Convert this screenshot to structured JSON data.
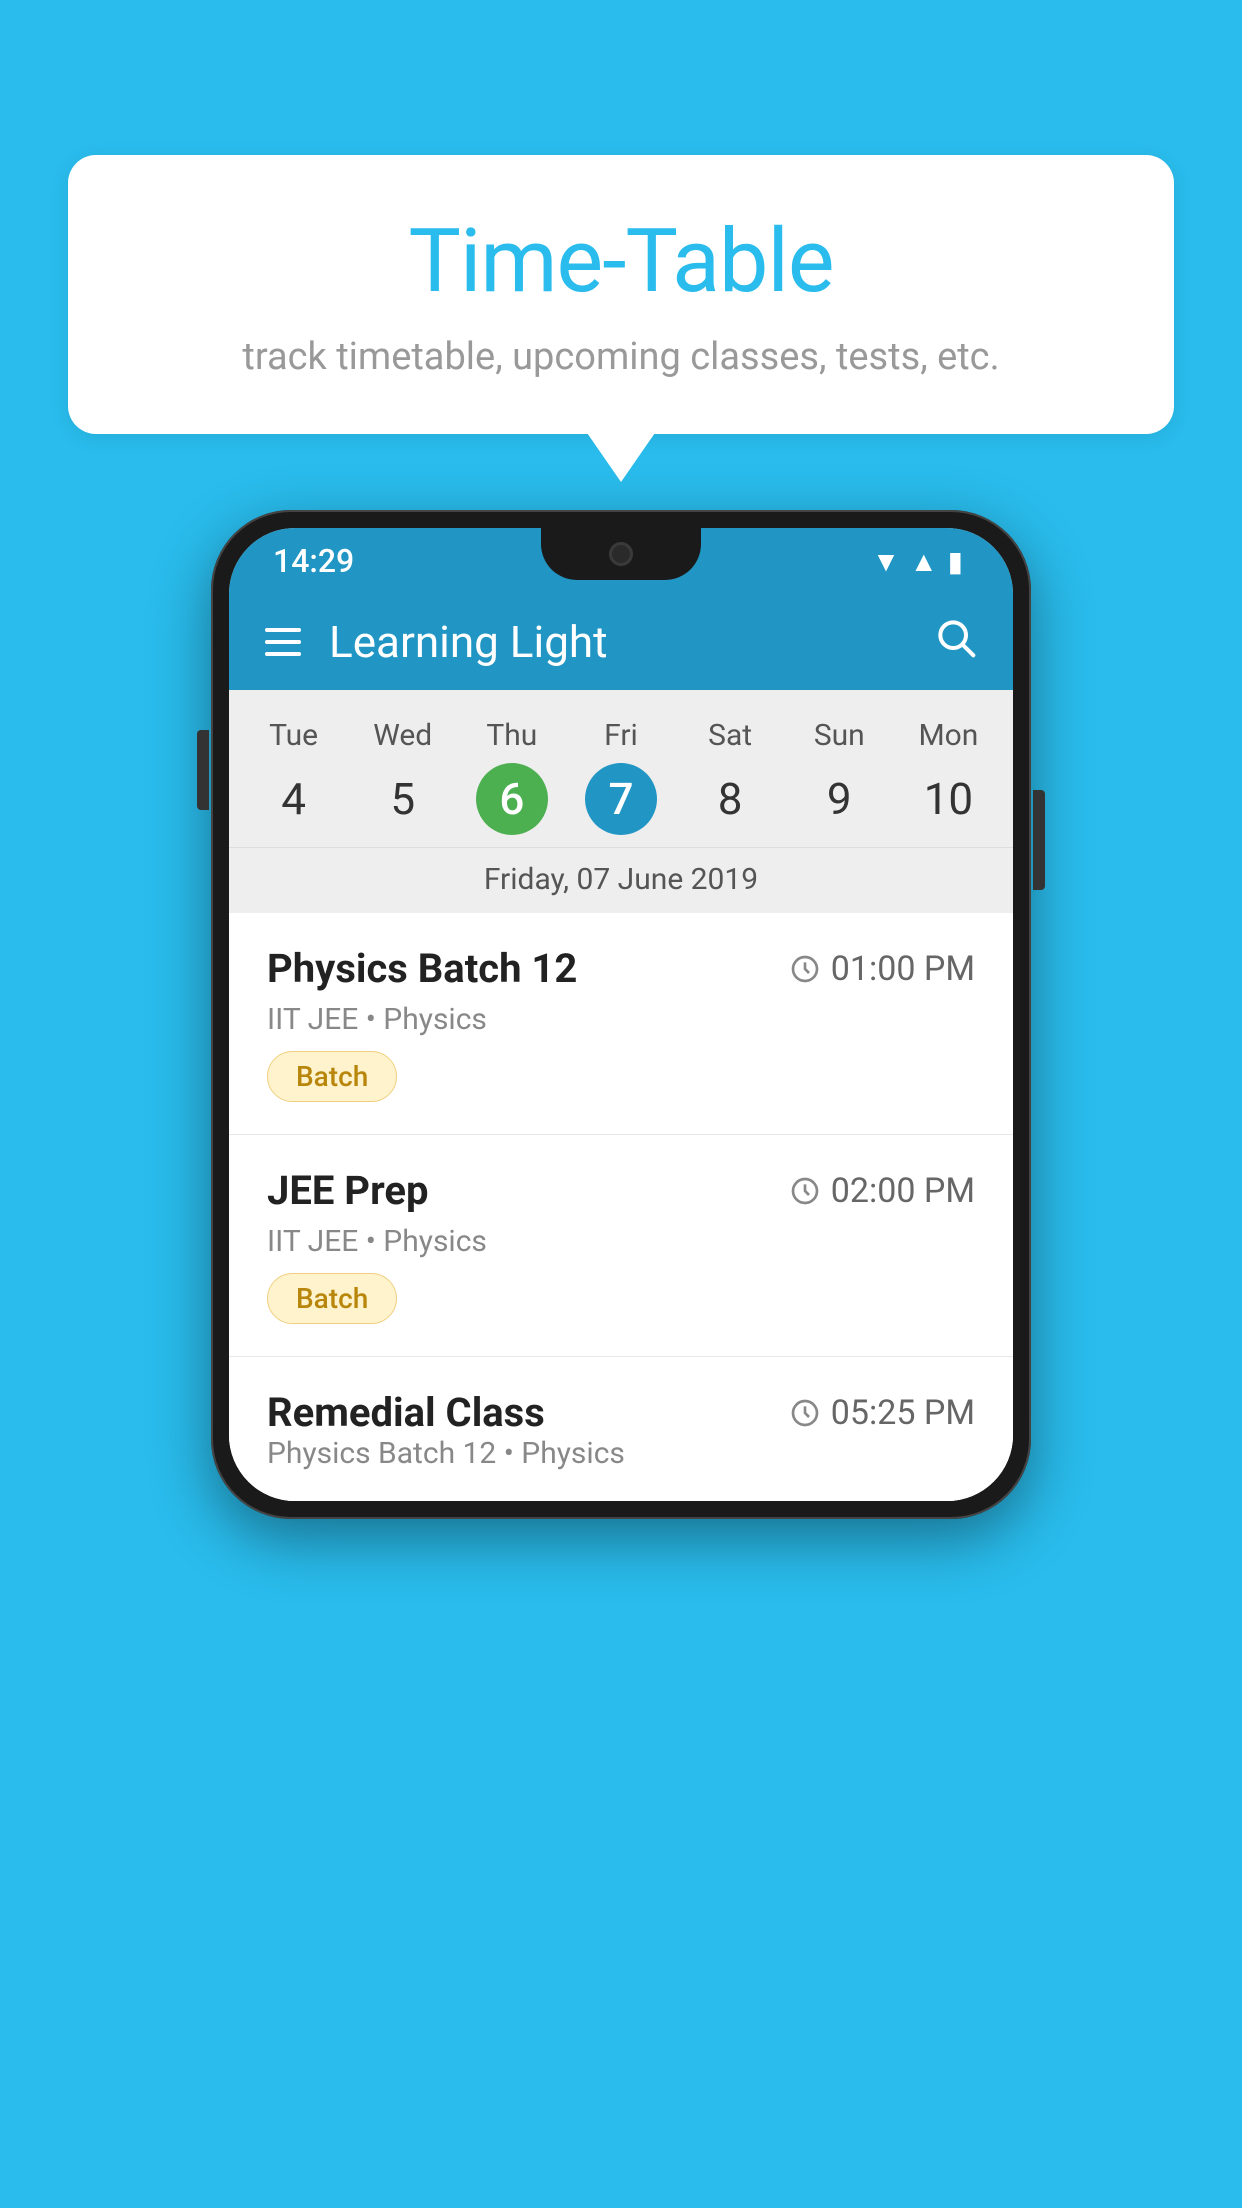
{
  "background_color": "#29BCEC",
  "speech_bubble": {
    "title": "Time-Table",
    "subtitle": "track timetable, upcoming classes, tests, etc."
  },
  "phone": {
    "status_bar": {
      "time": "14:29"
    },
    "header": {
      "title": "Learning Light"
    },
    "calendar": {
      "days": [
        {
          "label": "Tue",
          "number": "4"
        },
        {
          "label": "Wed",
          "number": "5"
        },
        {
          "label": "Thu",
          "number": "6",
          "state": "today"
        },
        {
          "label": "Fri",
          "number": "7",
          "state": "selected"
        },
        {
          "label": "Sat",
          "number": "8"
        },
        {
          "label": "Sun",
          "number": "9"
        },
        {
          "label": "Mon",
          "number": "10"
        }
      ],
      "selected_date_label": "Friday, 07 June 2019"
    },
    "schedule": [
      {
        "title": "Physics Batch 12",
        "time": "01:00 PM",
        "subtitle": "IIT JEE • Physics",
        "badge": "Batch"
      },
      {
        "title": "JEE Prep",
        "time": "02:00 PM",
        "subtitle": "IIT JEE • Physics",
        "badge": "Batch"
      },
      {
        "title": "Remedial Class",
        "time": "05:25 PM",
        "subtitle": "Physics Batch 12 • Physics",
        "badge": ""
      }
    ]
  }
}
